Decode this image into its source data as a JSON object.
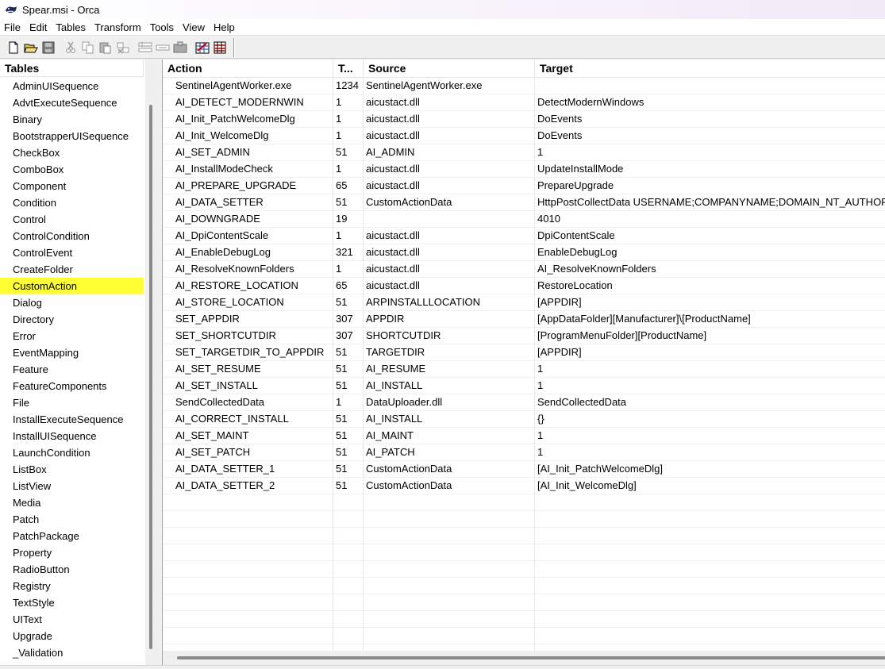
{
  "window": {
    "title": "Spear.msi - Orca"
  },
  "menu": [
    "File",
    "Edit",
    "Tables",
    "Transform",
    "Tools",
    "View",
    "Help"
  ],
  "toolbar": {
    "buttons": [
      "new-icon",
      "open-icon",
      "save-icon",
      "cut-icon",
      "copy-icon",
      "paste-icon",
      "delete-icon",
      "add-row-icon",
      "drop-row-icon",
      "import-icon",
      "validate-icon",
      "merge-module-icon"
    ]
  },
  "tables_pane": {
    "header": "Tables",
    "selected": "CustomAction",
    "items": [
      "AdminUISequence",
      "AdvtExecuteSequence",
      "Binary",
      "BootstrapperUISequence",
      "CheckBox",
      "ComboBox",
      "Component",
      "Condition",
      "Control",
      "ControlCondition",
      "ControlEvent",
      "CreateFolder",
      "CustomAction",
      "Dialog",
      "Directory",
      "Error",
      "EventMapping",
      "Feature",
      "FeatureComponents",
      "File",
      "InstallExecuteSequence",
      "InstallUISequence",
      "LaunchCondition",
      "ListBox",
      "ListView",
      "Media",
      "Patch",
      "PatchPackage",
      "Property",
      "RadioButton",
      "Registry",
      "TextStyle",
      "UIText",
      "Upgrade",
      "_Validation"
    ]
  },
  "grid": {
    "columns": [
      "Action",
      "T...",
      "Source",
      "Target"
    ],
    "rows": [
      [
        "SentinelAgentWorker.exe",
        "1234",
        "SentinelAgentWorker.exe",
        ""
      ],
      [
        "AI_DETECT_MODERNWIN",
        "1",
        "aicustact.dll",
        "DetectModernWindows"
      ],
      [
        "AI_Init_PatchWelcomeDlg",
        "1",
        "aicustact.dll",
        "DoEvents"
      ],
      [
        "AI_Init_WelcomeDlg",
        "1",
        "aicustact.dll",
        "DoEvents"
      ],
      [
        "AI_SET_ADMIN",
        "51",
        "AI_ADMIN",
        "1"
      ],
      [
        "AI_InstallModeCheck",
        "1",
        "aicustact.dll",
        "UpdateInstallMode"
      ],
      [
        "AI_PREPARE_UPGRADE",
        "65",
        "aicustact.dll",
        "PrepareUpgrade"
      ],
      [
        "AI_DATA_SETTER",
        "51",
        "CustomActionData",
        "HttpPostCollectData USERNAME;COMPANYNAME;DOMAIN_NT_AUTHORITY"
      ],
      [
        "AI_DOWNGRADE",
        "19",
        "",
        "4010"
      ],
      [
        "AI_DpiContentScale",
        "1",
        "aicustact.dll",
        "DpiContentScale"
      ],
      [
        "AI_EnableDebugLog",
        "321",
        "aicustact.dll",
        "EnableDebugLog"
      ],
      [
        "AI_ResolveKnownFolders",
        "1",
        "aicustact.dll",
        "AI_ResolveKnownFolders"
      ],
      [
        "AI_RESTORE_LOCATION",
        "65",
        "aicustact.dll",
        "RestoreLocation"
      ],
      [
        "AI_STORE_LOCATION",
        "51",
        "ARPINSTALLLOCATION",
        "[APPDIR]"
      ],
      [
        "SET_APPDIR",
        "307",
        "APPDIR",
        "[AppDataFolder][Manufacturer]\\[ProductName]"
      ],
      [
        "SET_SHORTCUTDIR",
        "307",
        "SHORTCUTDIR",
        "[ProgramMenuFolder][ProductName]"
      ],
      [
        "SET_TARGETDIR_TO_APPDIR",
        "51",
        "TARGETDIR",
        "[APPDIR]"
      ],
      [
        "AI_SET_RESUME",
        "51",
        "AI_RESUME",
        "1"
      ],
      [
        "AI_SET_INSTALL",
        "51",
        "AI_INSTALL",
        "1"
      ],
      [
        "SendCollectedData",
        "1",
        "DataUploader.dll",
        "SendCollectedData"
      ],
      [
        "AI_CORRECT_INSTALL",
        "51",
        "AI_INSTALL",
        "{}"
      ],
      [
        "AI_SET_MAINT",
        "51",
        "AI_MAINT",
        "1"
      ],
      [
        "AI_SET_PATCH",
        "51",
        "AI_PATCH",
        "1"
      ],
      [
        "AI_DATA_SETTER_1",
        "51",
        "CustomActionData",
        "[AI_Init_PatchWelcomeDlg]"
      ],
      [
        "AI_DATA_SETTER_2",
        "51",
        "CustomActionData",
        "[AI_Init_WelcomeDlg]"
      ]
    ],
    "empty_rows": 10
  },
  "colors": {
    "selected_table_bg": "#ffff33"
  }
}
